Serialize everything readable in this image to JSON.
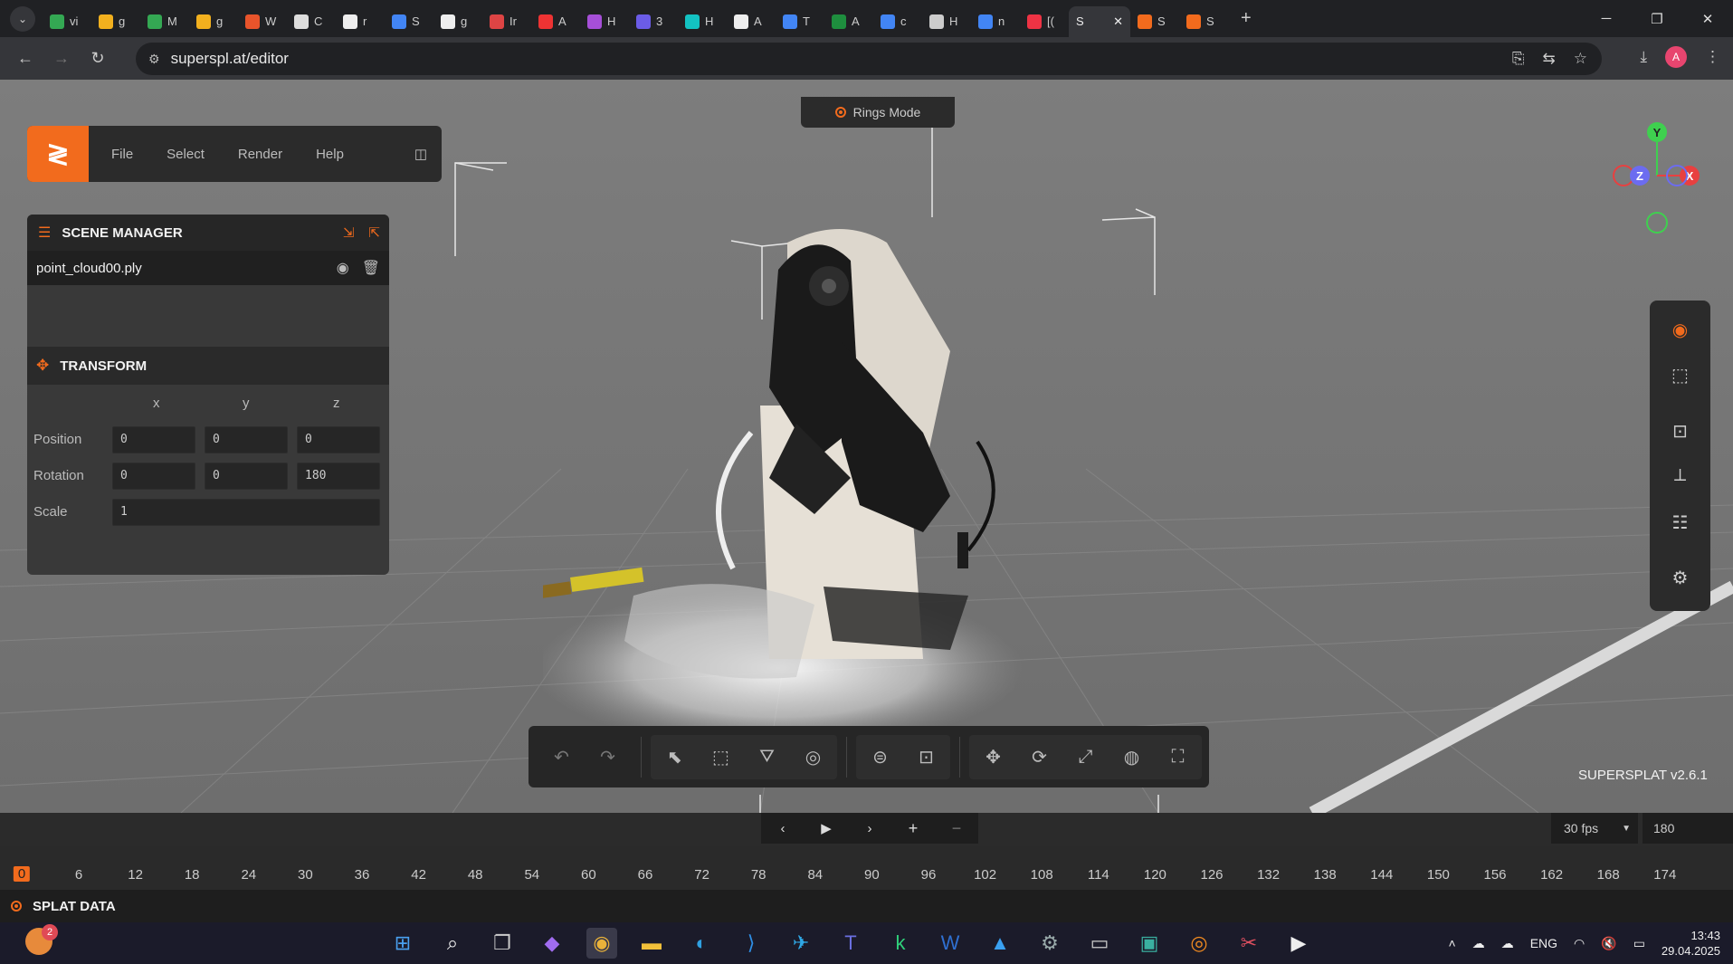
{
  "browser": {
    "tabs": [
      {
        "label": "vi",
        "color": "#34a853"
      },
      {
        "label": "g",
        "color": "#f2b01e"
      },
      {
        "label": "M",
        "color": "#34a853"
      },
      {
        "label": "g",
        "color": "#f2b01e"
      },
      {
        "label": "W",
        "color": "#e8542b"
      },
      {
        "label": "C",
        "color": "#ddd"
      },
      {
        "label": "r",
        "color": "#eee"
      },
      {
        "label": "S",
        "color": "#4285f4"
      },
      {
        "label": "g",
        "color": "#eee"
      },
      {
        "label": "Ir",
        "color": "#d44"
      },
      {
        "label": "A",
        "color": "#e33"
      },
      {
        "label": "H",
        "color": "#a64fd8"
      },
      {
        "label": "3",
        "color": "#6b5ce7"
      },
      {
        "label": "H",
        "color": "#13c2c2"
      },
      {
        "label": "A",
        "color": "#eee"
      },
      {
        "label": "T",
        "color": "#4285f4"
      },
      {
        "label": "A",
        "color": "#1e8e3e"
      },
      {
        "label": "c",
        "color": "#4285f4"
      },
      {
        "label": "H",
        "color": "#ccc"
      },
      {
        "label": "n",
        "color": "#4285f4"
      },
      {
        "label": "[(",
        "color": "#e34"
      }
    ],
    "active_tab": {
      "label": "S",
      "close": "✕"
    },
    "after_tabs": [
      {
        "label": "S",
        "color": "#f26b1d"
      },
      {
        "label": "S",
        "color": "#f26b1d"
      }
    ],
    "url": "superspl.at/editor",
    "profile_initial": "A"
  },
  "app": {
    "menu": [
      "File",
      "Select",
      "Render",
      "Help"
    ],
    "rings_mode": "Rings Mode",
    "scene_manager": {
      "title": "SCENE MANAGER",
      "file": "point_cloud00.ply"
    },
    "transform": {
      "title": "TRANSFORM",
      "axes": [
        "x",
        "y",
        "z"
      ],
      "position_label": "Position",
      "position": [
        "0",
        "0",
        "0"
      ],
      "rotation_label": "Rotation",
      "rotation": [
        "0",
        "0",
        "180"
      ],
      "scale_label": "Scale",
      "scale": "1"
    },
    "gizmo": {
      "x": "X",
      "y": "Y",
      "z": "Z"
    },
    "version": "SUPERSPLAT v2.6.1",
    "timeline": {
      "fps": "30 fps",
      "frames": "180",
      "current_frame": "0",
      "ticks": [
        "6",
        "12",
        "18",
        "24",
        "30",
        "36",
        "42",
        "48",
        "54",
        "60",
        "66",
        "72",
        "78",
        "84",
        "90",
        "96",
        "102",
        "108",
        "114",
        "120",
        "126",
        "132",
        "138",
        "144",
        "150",
        "156",
        "162",
        "168",
        "174"
      ]
    },
    "splat_data": "SPLAT DATA"
  },
  "taskbar": {
    "widget_badge": "2",
    "language": "ENG",
    "time": "13:43",
    "date": "29.04.2025"
  }
}
